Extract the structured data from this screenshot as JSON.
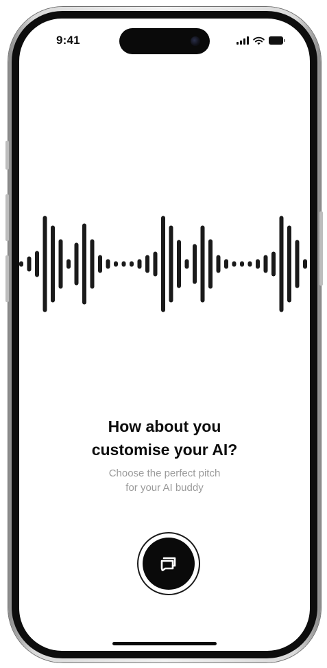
{
  "status_bar": {
    "time": "9:41",
    "icons": [
      "signal-icon",
      "wifi-icon",
      "battery-icon"
    ]
  },
  "main": {
    "headline_lines": [
      "How about you",
      "customise your AI?"
    ],
    "subtext_lines": [
      "Choose the perfect pitch",
      "for your AI buddy"
    ]
  },
  "action_button": {
    "icon": "chat-bubbles-icon"
  },
  "colors": {
    "background": "#ffffff",
    "primary": "#0a0a0a",
    "subtext": "#9a9a9a"
  }
}
